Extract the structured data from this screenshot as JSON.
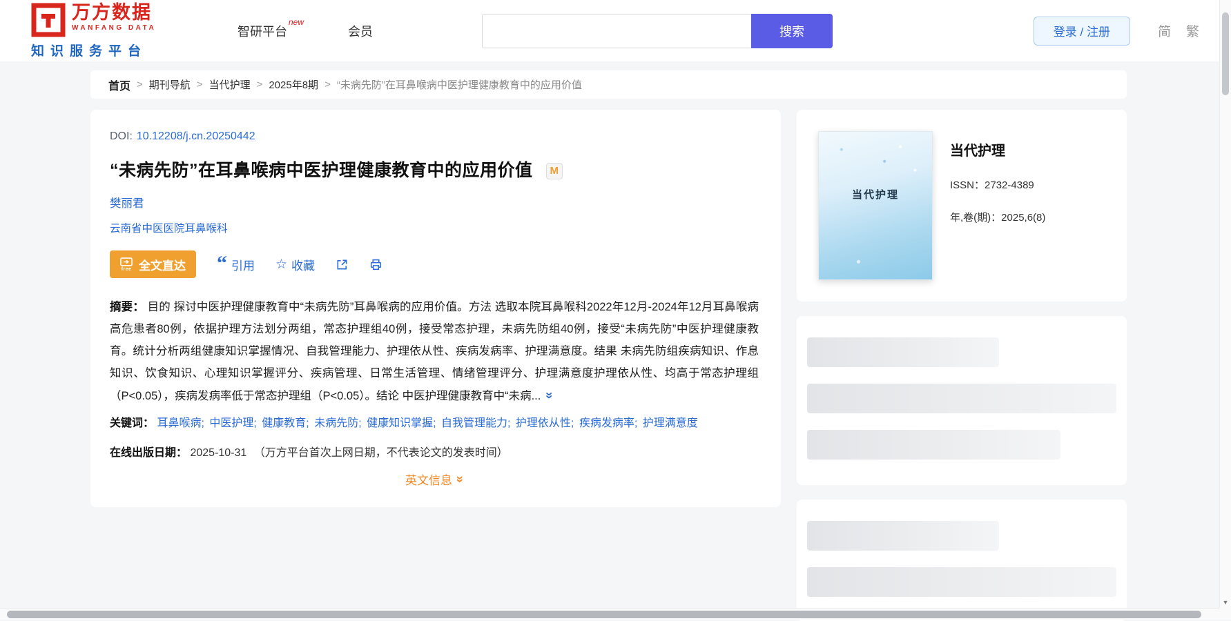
{
  "colors": {
    "brand_red": "#d9261d",
    "link_blue": "#2a6bd4",
    "search_button_blue": "#5a5ce6",
    "fulltext_orange": "#f0a02f",
    "english_info_orange": "#f08c2a"
  },
  "header": {
    "logo": {
      "brand_cn": "万方数据",
      "brand_en": "WANFANG DATA",
      "tagline": "知识服务平台"
    },
    "nav": [
      {
        "label": "智研平台",
        "badge": "new"
      },
      {
        "label": "会员",
        "badge": ""
      }
    ],
    "search": {
      "button_label": "搜索",
      "value": ""
    },
    "login_label": "登录 / 注册",
    "lang": {
      "simplified": "简",
      "traditional": "繁"
    }
  },
  "breadcrumb": {
    "separator": ">",
    "items": [
      "首页",
      "期刊导航",
      "当代护理",
      "2025年8期",
      "“未病先防”在耳鼻喉病中医护理健康教育中的应用价值"
    ]
  },
  "article": {
    "doi_label": "DOI:",
    "doi": "10.12208/j.cn.20250442",
    "title": "“未病先防”在耳鼻喉病中医护理健康教育中的应用价值",
    "title_badge": "M",
    "author": "樊丽君",
    "affiliation": "云南省中医医院耳鼻喉科",
    "actions": {
      "fulltext": "全文直达",
      "fulltext_tag": "free",
      "cite": "引用",
      "favorite": "收藏"
    },
    "abstract_label": "摘要：",
    "abstract": "目的 探讨中医护理健康教育中“未病先防”耳鼻喉病的应用价值。方法 选取本院耳鼻喉科2022年12月-2024年12月耳鼻喉病高危患者80例，依据护理方法划分两组，常态护理组40例，接受常态护理，未病先防组40例，接受“未病先防”中医护理健康教育。统计分析两组健康知识掌握情况、自我管理能力、护理依从性、疾病发病率、护理满意度。结果 未病先防组疾病知识、作息知识、饮食知识、心理知识掌握评分、疾病管理、日常生活管理、情绪管理评分、护理满意度护理依从性、均高于常态护理组（P<0.05），疾病发病率低于常态护理组（P<0.05）。结论 中医护理健康教育中“未病...",
    "keyword_separator": ";",
    "keywords_label": "关键词：",
    "keywords": [
      "耳鼻喉病",
      "中医护理",
      "健康教育",
      "未病先防",
      "健康知识掌握",
      "自我管理能力",
      "护理依从性",
      "疾病发病率",
      "护理满意度"
    ],
    "publish_label": "在线出版日期：",
    "publish_date": "2025-10-31",
    "publish_note": "（万方平台首次上网日期，不代表论文的发表时间）",
    "english_info": "英文信息"
  },
  "journal": {
    "cover_title": "当代护理",
    "name": "当代护理",
    "issn_label": "ISSN：",
    "issn": "2732-4389",
    "volume_label": "年,卷(期)：",
    "volume": "2025,6(8)"
  }
}
